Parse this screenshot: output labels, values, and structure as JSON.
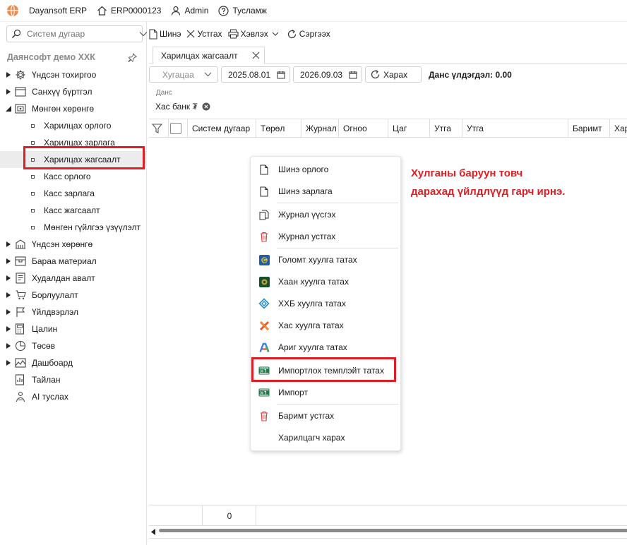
{
  "titlebar": {
    "app_name": "Dayansoft ERP",
    "company_code": "ERP0000123",
    "user": "Admin",
    "help": "Тусламж"
  },
  "sidebar": {
    "search_placeholder": "Систем дугаар",
    "company": "Даянсофт демо ХХК",
    "items": [
      {
        "label": "Үндсэн тохиргоо",
        "icon": "gear-icon"
      },
      {
        "label": "Санхүү бүртгэл",
        "icon": "ledger-icon"
      },
      {
        "label": "Мөнгөн хөрөнгө",
        "icon": "cash-icon"
      },
      {
        "label": "Харилцах орлого"
      },
      {
        "label": "Харилцах зарлага"
      },
      {
        "label": "Харилцах жагсаалт"
      },
      {
        "label": "Касс орлого"
      },
      {
        "label": "Касс зарлага"
      },
      {
        "label": "Касс жагсаалт"
      },
      {
        "label": "Мөнген гүйлгээ үзүүлэлт"
      },
      {
        "label": "Үндсэн хөрөнгө",
        "icon": "building-icon"
      },
      {
        "label": "Бараа материал",
        "icon": "box-icon"
      },
      {
        "label": "Худалдан авалт",
        "icon": "cart-icon"
      },
      {
        "label": "Борлуулалт",
        "icon": "sales-icon"
      },
      {
        "label": "Үйлдвэрлэл",
        "icon": "factory-icon"
      },
      {
        "label": "Цалин",
        "icon": "calculator-icon"
      },
      {
        "label": "Төсөв",
        "icon": "pie-icon"
      },
      {
        "label": "Дашбоард",
        "icon": "dashboard-icon"
      },
      {
        "label": "Тайлан",
        "icon": "report-icon"
      },
      {
        "label": "AI туслах",
        "icon": "ai-icon"
      }
    ]
  },
  "toolbar": {
    "new_label": "Шинэ",
    "delete_label": "Устгах",
    "print_label": "Хэвлэх",
    "refresh_label": "Сэргээх"
  },
  "tab": {
    "title": "Харилцах жагсаалт"
  },
  "filter": {
    "period_placeholder": "Хугацаа",
    "date_from": "2025.08.01",
    "date_to": "2026.09.03",
    "view_label": "Харах",
    "balance": "Данс үлдэгдэл: 0.00"
  },
  "account": {
    "label": "Данс",
    "value": "Хас банк ₮"
  },
  "grid": {
    "columns": [
      "Систем дугаар",
      "Төрөл",
      "Журнал",
      "Огноо",
      "Цаг",
      "Утга",
      "Утга",
      "Баримт",
      "Хар"
    ],
    "row_count": "0"
  },
  "context_menu": {
    "items": [
      {
        "label": "Шинэ орлого",
        "icon": "document-icon"
      },
      {
        "label": "Шинэ зарлага",
        "icon": "document-icon"
      },
      {
        "label": "Журнал үүсгэх",
        "icon": "copy-icon"
      },
      {
        "label": "Журнал устгах",
        "icon": "trash-icon"
      },
      {
        "label": "Голомт хуулга татах",
        "icon": "golomt-bank-icon"
      },
      {
        "label": "Хаан хуулга татах",
        "icon": "khan-bank-icon"
      },
      {
        "label": "ХХБ хуулга татах",
        "icon": "tdb-bank-icon"
      },
      {
        "label": "Хас хуулга татах",
        "icon": "xac-bank-icon"
      },
      {
        "label": "Ариг хуулга татах",
        "icon": "arig-bank-icon"
      },
      {
        "label": "Импортлох темплэйт татах",
        "icon": "excel-icon"
      },
      {
        "label": "Импорт",
        "icon": "excel-icon"
      },
      {
        "label": "Баримт устгах",
        "icon": "trash-icon"
      },
      {
        "label": "Харилцагч харах",
        "icon": ""
      }
    ]
  },
  "annotation": {
    "text": "Хулганы баруун товч дарахад үйлдлүүд гарч ирнэ."
  },
  "colors": {
    "highlight": "#e01d22",
    "annotation": "#e01d22"
  }
}
